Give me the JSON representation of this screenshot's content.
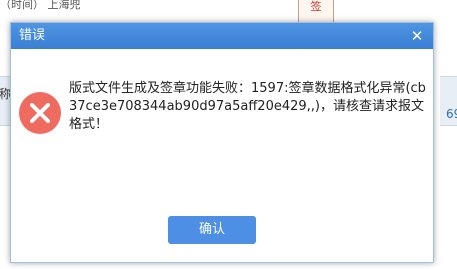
{
  "background": {
    "top_text": "（时间）  上海兜",
    "red_tab_text": "签",
    "left_col_text": "称",
    "right_col_text": "69"
  },
  "dialog": {
    "title": "错误",
    "close_symbol": "✕",
    "icon": "error-x-icon",
    "message": "版式文件生成及签章功能失败：1597:签章数据格式化异常(cb37ce3e708344ab90d97a5aff20e429,,)，请核查请求报文格式！",
    "ok_label": "确认"
  },
  "colors": {
    "titlebar": "#3a7fd4",
    "error_icon": "#ef6b60",
    "ok_button": "#4e8fe6"
  }
}
